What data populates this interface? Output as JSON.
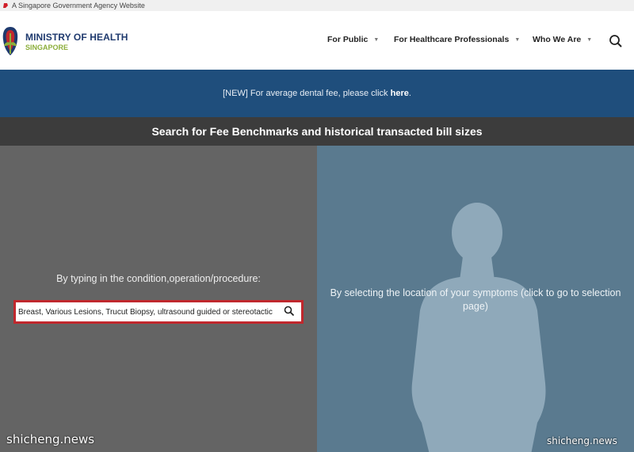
{
  "gov_bar": {
    "text": "A Singapore Government Agency Website"
  },
  "logo": {
    "name": "MINISTRY OF HEALTH",
    "country": "SINGAPORE"
  },
  "nav": [
    {
      "label": "For Public"
    },
    {
      "label": "For Healthcare Professionals"
    },
    {
      "label": "Who We Are"
    }
  ],
  "banner": {
    "prefix": "[NEW] For average dental fee, please click ",
    "link": "here",
    "suffix": "."
  },
  "title": "Search for Fee Benchmarks and historical transacted bill sizes",
  "left_panel": {
    "label": "By typing in the condition,operation/procedure:",
    "search_value": "Breast, Various Lesions, Trucut Biopsy, ultrasound guided or stereotactic"
  },
  "right_panel": {
    "label": "By selecting the location of your symptoms (click to go to selection page)"
  },
  "watermark": {
    "left": "shicheng.news",
    "right": "shicheng.news"
  },
  "colors": {
    "banner": "#1f4e7c",
    "title_bar": "#3c3c3c",
    "left_panel": "#646464",
    "right_panel": "#5a7a8f",
    "search_border": "#c0282d",
    "logo_text": "#1f3a6e",
    "logo_sub": "#8cae3b"
  }
}
